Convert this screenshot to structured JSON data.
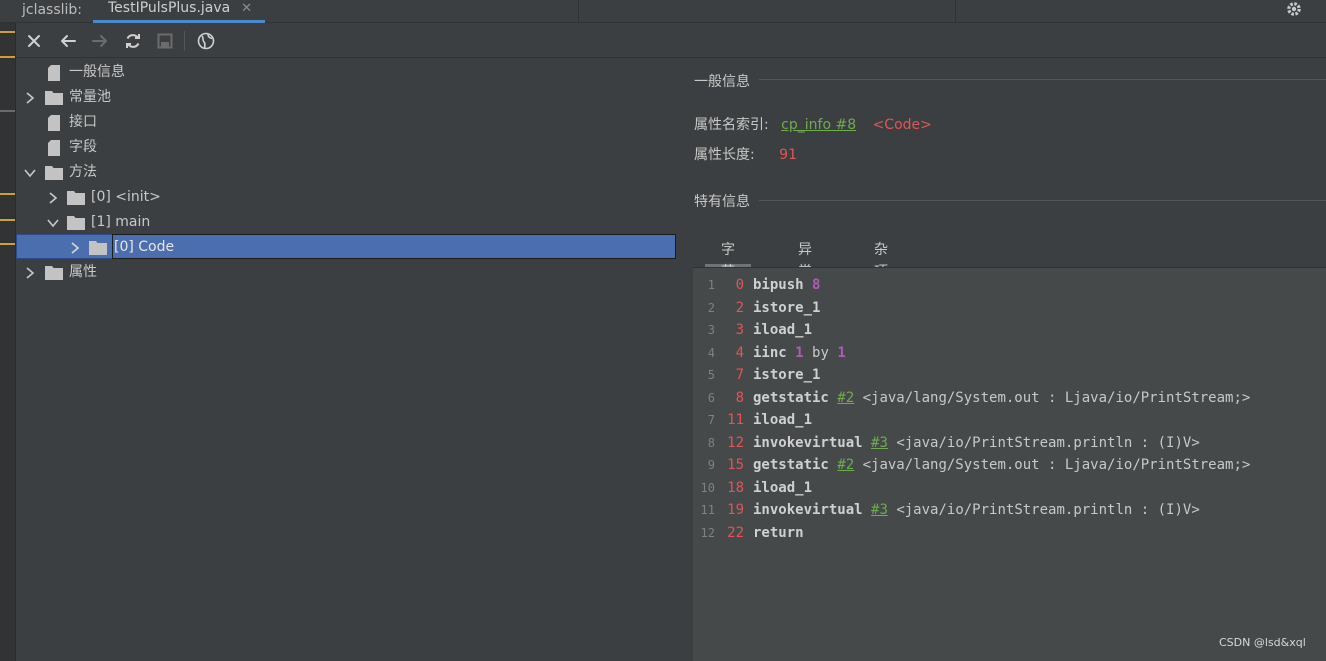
{
  "tabbar": {
    "tool_label": "jclasslib:",
    "tab_label": "TestIPulsPlus.java",
    "close_glyph": "✕"
  },
  "toolbar": {
    "icons": [
      "close-icon",
      "back-arrow-icon",
      "forward-arrow-icon",
      "refresh-icon",
      "save-icon",
      "web-icon"
    ]
  },
  "tree": {
    "items": [
      {
        "label": "一般信息",
        "icon": "file-icon"
      },
      {
        "label": "常量池",
        "icon": "folder-icon",
        "expanded": false
      },
      {
        "label": "接口",
        "icon": "file-icon"
      },
      {
        "label": "字段",
        "icon": "file-icon"
      },
      {
        "label": "方法",
        "icon": "folder-icon",
        "expanded": true
      },
      {
        "label": "[0] <init>",
        "icon": "folder-icon",
        "expanded": false
      },
      {
        "label": "[1] main",
        "icon": "folder-icon",
        "expanded": true
      },
      {
        "label": "[0] Code",
        "icon": "folder-icon",
        "expanded": false,
        "selected": true
      },
      {
        "label": "属性",
        "icon": "folder-icon",
        "expanded": false
      }
    ]
  },
  "detail": {
    "general_heading": "一般信息",
    "name_index_label": "属性名索引:",
    "name_index_link": "cp_info #8",
    "name_index_value": "<Code>",
    "length_label": "属性长度:",
    "length_value": "91",
    "specific_heading": "特有信息",
    "tabs": [
      "字节码",
      "异常表",
      "杂项"
    ],
    "active_tab": "字节码"
  },
  "bytecode": [
    {
      "line": "1",
      "offset": "0",
      "op": "bipush",
      "args": [
        {
          "t": "num",
          "v": "8"
        }
      ]
    },
    {
      "line": "2",
      "offset": "2",
      "op": "istore_1",
      "args": []
    },
    {
      "line": "3",
      "offset": "3",
      "op": "iload_1",
      "args": []
    },
    {
      "line": "4",
      "offset": "4",
      "op": "iinc",
      "args": [
        {
          "t": "num",
          "v": "1"
        },
        {
          "t": "txt",
          "v": "by"
        },
        {
          "t": "num",
          "v": "1"
        }
      ]
    },
    {
      "line": "5",
      "offset": "7",
      "op": "istore_1",
      "args": []
    },
    {
      "line": "6",
      "offset": "8",
      "op": "getstatic",
      "args": [
        {
          "t": "ref",
          "v": "#2"
        },
        {
          "t": "txt",
          "v": "<java/lang/System.out : Ljava/io/PrintStream;>"
        }
      ]
    },
    {
      "line": "7",
      "offset": "11",
      "op": "iload_1",
      "args": []
    },
    {
      "line": "8",
      "offset": "12",
      "op": "invokevirtual",
      "args": [
        {
          "t": "ref",
          "v": "#3"
        },
        {
          "t": "txt",
          "v": "<java/io/PrintStream.println : (I)V>"
        }
      ]
    },
    {
      "line": "9",
      "offset": "15",
      "op": "getstatic",
      "args": [
        {
          "t": "ref",
          "v": "#2"
        },
        {
          "t": "txt",
          "v": "<java/lang/System.out : Ljava/io/PrintStream;>"
        }
      ]
    },
    {
      "line": "10",
      "offset": "18",
      "op": "iload_1",
      "args": []
    },
    {
      "line": "11",
      "offset": "19",
      "op": "invokevirtual",
      "args": [
        {
          "t": "ref",
          "v": "#3"
        },
        {
          "t": "txt",
          "v": "<java/io/PrintStream.println : (I)V>"
        }
      ]
    },
    {
      "line": "12",
      "offset": "22",
      "op": "return",
      "args": []
    }
  ],
  "watermark": "CSDN @lsd&xql",
  "colors": {
    "background": "#3c3f41",
    "selection": "#4b6eaf",
    "accent_tab": "#4a88c7",
    "offset_red": "#e05555",
    "number_purple": "#b35ab5",
    "reference_green": "#6fab4f",
    "code_bg": "#45494a"
  }
}
